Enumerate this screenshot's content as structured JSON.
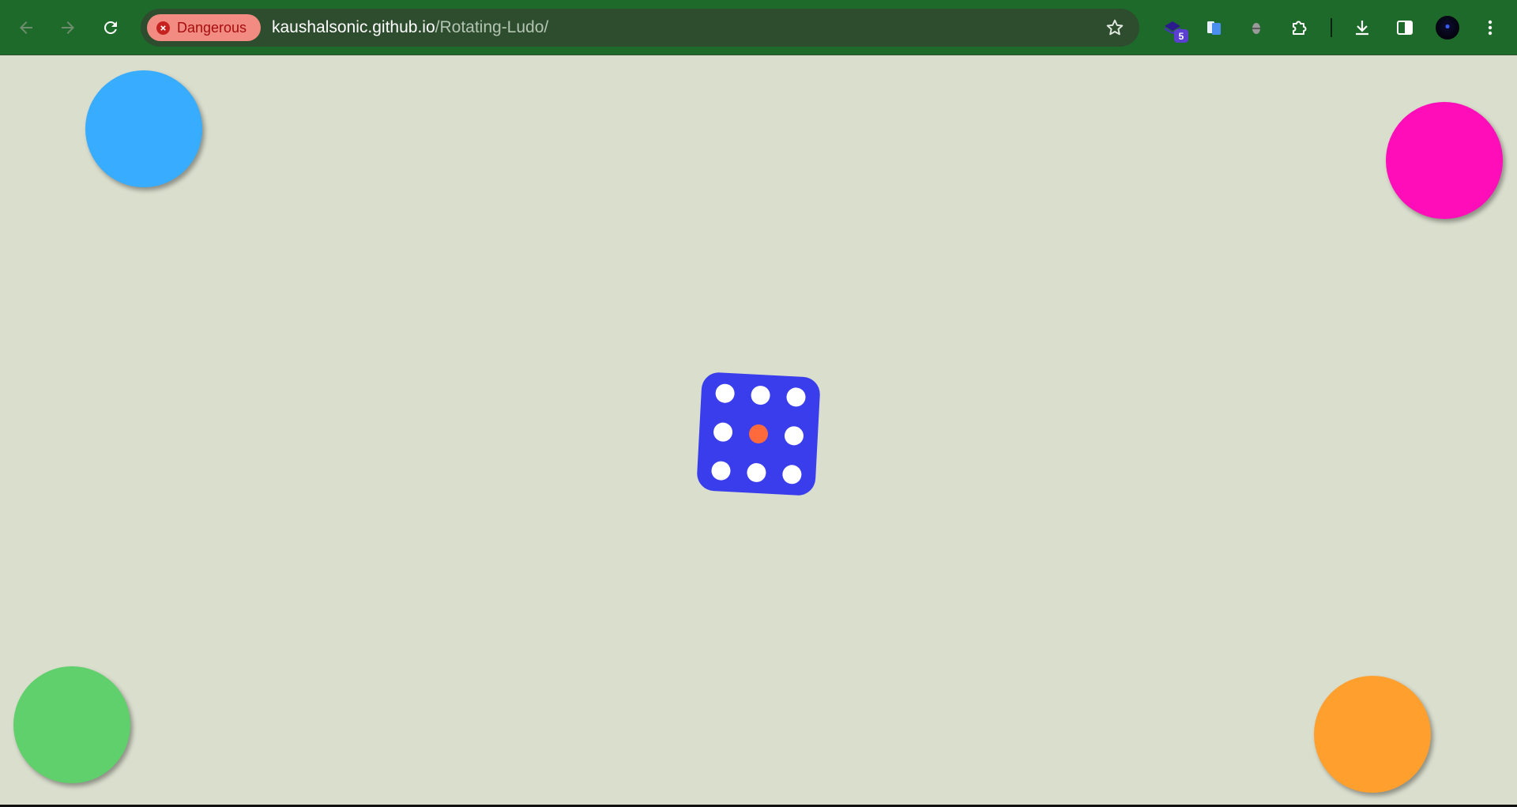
{
  "colors": {
    "toolbar_bg": "#1e6a2a",
    "page_bg": "#dadecd",
    "token_blue": "#38acff",
    "token_pink": "#ff0db9",
    "token_green": "#5fd06b",
    "token_orange": "#ff9f2e",
    "dice_bg": "#3a3deb",
    "pip_white": "#ffffff",
    "pip_center": "#ff6a3d"
  },
  "browser": {
    "security_chip": {
      "label": "Dangerous",
      "icon": "error-x-icon"
    },
    "url": {
      "host": "kaushalsonic.github.io",
      "path": "/Rotating-Ludo/"
    },
    "extension_badge": "5",
    "icons": [
      "back-arrow-icon",
      "forward-arrow-icon",
      "reload-icon",
      "bookmark-star-icon",
      "extension-stack-icon",
      "extension-pages-icon",
      "extension-blob-icon",
      "puzzle-icon",
      "download-icon",
      "side-panel-icon",
      "profile-avatar",
      "kebab-menu-icon"
    ]
  },
  "game": {
    "tokens": [
      "blue",
      "pink",
      "green",
      "orange"
    ],
    "dice": {
      "pips": 9,
      "highlighted_center": true
    }
  }
}
